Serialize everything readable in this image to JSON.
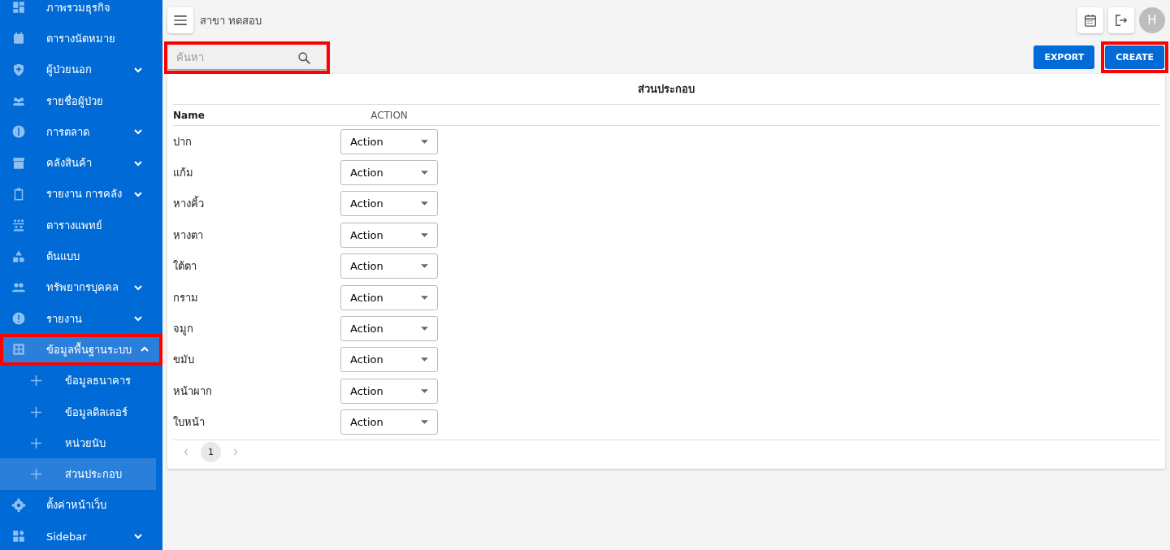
{
  "sidebar": {
    "items": [
      {
        "label": "ภาพรวมธุรกิจ",
        "selected": false,
        "highlighted": false
      },
      {
        "label": "ตารางนัดหมาย",
        "selected": false,
        "highlighted": false
      },
      {
        "label": "ผู้ป่วยนอก",
        "expanded": false,
        "selected": false,
        "highlighted": false
      },
      {
        "label": "รายชื่อผู้ป่วย",
        "selected": false,
        "highlighted": false
      },
      {
        "label": "การตลาด",
        "expanded": false,
        "selected": false,
        "highlighted": false
      },
      {
        "label": "คลังสินค้า",
        "expanded": false,
        "selected": false,
        "highlighted": false
      },
      {
        "label": "รายงาน การคลัง",
        "expanded": false,
        "selected": false,
        "highlighted": false
      },
      {
        "label": "ตารางแพทย์",
        "selected": false,
        "highlighted": false
      },
      {
        "label": "ต้นแบบ",
        "selected": false,
        "highlighted": false
      },
      {
        "label": "ทรัพยากรบุคคล",
        "expanded": false,
        "selected": false,
        "highlighted": false
      },
      {
        "label": "รายงาน",
        "expanded": false,
        "selected": false,
        "highlighted": false
      },
      {
        "label": "ข้อมูลพื้นฐานระบบ",
        "expanded": true,
        "selected": true,
        "highlighted": true,
        "children": [
          {
            "label": "ข้อมูลธนาคาร",
            "selected": false
          },
          {
            "label": "ข้อมูลดิลเลอร์",
            "selected": false
          },
          {
            "label": "หน่วยนับ",
            "selected": false
          },
          {
            "label": "ส่วนประกอบ",
            "selected": true
          }
        ]
      },
      {
        "label": "ตั้งค่าหน้าเว็บ",
        "selected": false,
        "highlighted": false
      },
      {
        "label": "Sidebar",
        "expanded": false,
        "selected": false,
        "highlighted": false
      }
    ]
  },
  "topbar": {
    "branch": "สาขา ทดสอบ",
    "avatar": "H"
  },
  "search": {
    "placeholder": "ค้นหา",
    "highlighted": true
  },
  "buttons": [
    {
      "label": "EXPORT",
      "highlighted": false
    },
    {
      "label": "CREATE",
      "highlighted": true
    }
  ],
  "table": {
    "title": "ส่วนประกอบ",
    "columns": [
      "Name",
      "ACTION"
    ],
    "rows": [
      {
        "name": "ปาก",
        "action": "Action"
      },
      {
        "name": "แก้ม",
        "action": "Action"
      },
      {
        "name": "หางคิ้ว",
        "action": "Action"
      },
      {
        "name": "หางตา",
        "action": "Action"
      },
      {
        "name": "ใต้ตา",
        "action": "Action"
      },
      {
        "name": "กราม",
        "action": "Action"
      },
      {
        "name": "จมูก",
        "action": "Action"
      },
      {
        "name": "ขมับ",
        "action": "Action"
      },
      {
        "name": "หน้าผาก",
        "action": "Action"
      },
      {
        "name": "ใบหน้า",
        "action": "Action"
      }
    ]
  },
  "pagination": {
    "pages": [
      {
        "label": "1",
        "selected": true
      }
    ]
  }
}
